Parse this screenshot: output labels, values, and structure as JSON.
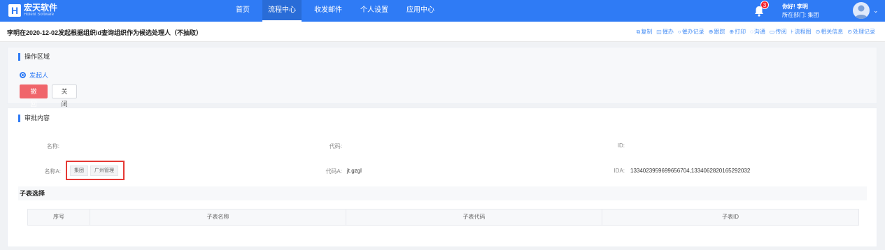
{
  "brand": {
    "logo_mark": "H",
    "name": "宏天软件",
    "subtitle": "Hotent Software"
  },
  "nav": {
    "items": [
      {
        "label": "首页",
        "active": false
      },
      {
        "label": "流程中心",
        "active": true
      },
      {
        "label": "收发邮件",
        "active": false
      },
      {
        "label": "个人设置",
        "active": false
      },
      {
        "label": "应用中心",
        "active": false
      }
    ]
  },
  "header": {
    "notification_count": "3",
    "greeting": "你好! 李明",
    "department": "所在部门: 集团"
  },
  "document": {
    "title": "李明在2020-12-02发起根据组织id查询组织作为候选处理人（不抽取）"
  },
  "toolbar": {
    "items": [
      {
        "icon": "copy-icon",
        "glyph": "⧉",
        "label": "复制"
      },
      {
        "icon": "urge-icon",
        "glyph": "◫",
        "label": "催办"
      },
      {
        "icon": "search-icon",
        "glyph": "○",
        "label": "催办记录"
      },
      {
        "icon": "follow-icon",
        "glyph": "⊕",
        "label": "跟踪"
      },
      {
        "icon": "print-icon",
        "glyph": "⊕",
        "label": "打印"
      },
      {
        "icon": "communicate-icon",
        "glyph": "◌",
        "label": "沟通"
      },
      {
        "icon": "circulate-icon",
        "glyph": "▭",
        "label": "传阅"
      },
      {
        "icon": "flowchart-icon",
        "glyph": "⊦",
        "label": "流程图"
      },
      {
        "icon": "related-info-icon",
        "glyph": "⊙",
        "label": "相关信息"
      },
      {
        "icon": "history-icon",
        "glyph": "⊙",
        "label": "处理记录"
      }
    ]
  },
  "operation": {
    "section_title": "操作区域",
    "radio_label": "发起人",
    "withdraw_label": "撤 回",
    "close_label": "关闭"
  },
  "approval": {
    "section_title": "审批内容",
    "row1": {
      "name_label": "名称:",
      "code_label": "代码:",
      "id_label": "ID:"
    },
    "row2": {
      "name_label": "名称A:",
      "tags": [
        "集团",
        "广州管理"
      ],
      "code_label": "代码A:",
      "code_value": "jt.gzgl",
      "id_label": "IDA:",
      "id_value": "1334023959699656704,1334062820165292032"
    },
    "subtable_title": "子表选择",
    "columns": [
      "序号",
      "子表名称",
      "子表代码",
      "子表ID"
    ]
  },
  "colors": {
    "primary": "#2f7bf5",
    "danger": "#f0656b",
    "highlight_box": "#e53935"
  }
}
